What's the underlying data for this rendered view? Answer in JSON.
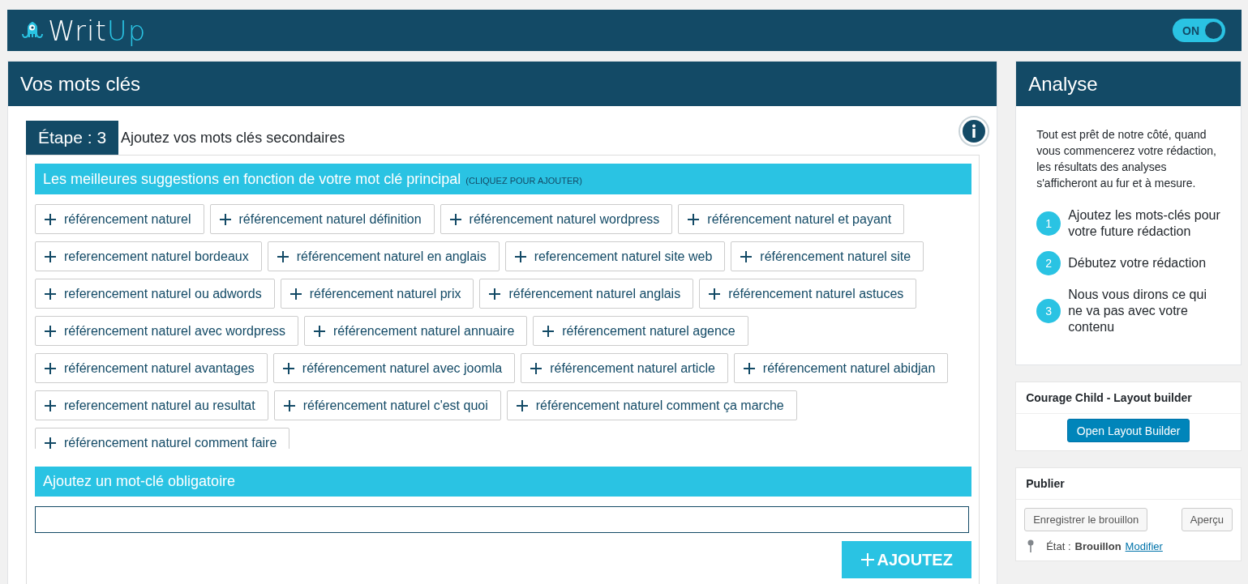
{
  "header": {
    "logo": {
      "part_1": "Writ",
      "part_2": "Up"
    },
    "toggle": {
      "label": "ON",
      "on": true
    }
  },
  "keywords_panel": {
    "title": "Vos mots clés",
    "step": {
      "label": "Étape : 3",
      "text": "Ajoutez vos mots clés secondaires"
    },
    "suggestions": {
      "title": "Les meilleures suggestions en fonction de votre mot clé principal",
      "hint": "(CLIQUEZ POUR AJOUTER)",
      "items": [
        "référencement naturel",
        "référencement naturel définition",
        "référencement naturel wordpress",
        "référencement naturel et payant",
        "referencement naturel bordeaux",
        "référencement naturel en anglais",
        "referencement naturel site web",
        "référencement naturel site",
        "referencement naturel ou adwords",
        "référencement naturel prix",
        "référencement naturel anglais",
        "référencement naturel astuces",
        "référencement naturel avec wordpress",
        "référencement naturel annuaire",
        "référencement naturel agence",
        "référencement naturel avantages",
        "référencement naturel avec joomla",
        "référencement naturel article",
        "référencement naturel abidjan",
        "referencement naturel au resultat",
        "référencement naturel c'est quoi",
        "référencement naturel comment ça marche",
        "référencement naturel comment faire"
      ]
    },
    "mandatory": {
      "title": "Ajoutez un mot-clé obligatoire",
      "button": "AJOUTEZ"
    }
  },
  "analysis_panel": {
    "title": "Analyse",
    "intro": "Tout est prêt de notre côté, quand vous commencerez votre rédaction, les résultats des analyses s'afficheront au fur et à mesure.",
    "steps": [
      {
        "number": "1",
        "text": "Ajoutez les mots-clés pour votre future rédaction"
      },
      {
        "number": "2",
        "text": "Débutez votre rédaction"
      },
      {
        "number": "3",
        "text": "Nous vous dirons ce qui ne va pas avec votre contenu"
      }
    ]
  },
  "layout_builder": {
    "title": "Courage Child - Layout builder",
    "button": "Open Layout Builder"
  },
  "publish": {
    "title": "Publier",
    "save_button": "Enregistrer le brouillon",
    "preview_button": "Aperçu",
    "status_label": "État :",
    "status_value": "Brouillon",
    "status_link": "Modifier"
  }
}
